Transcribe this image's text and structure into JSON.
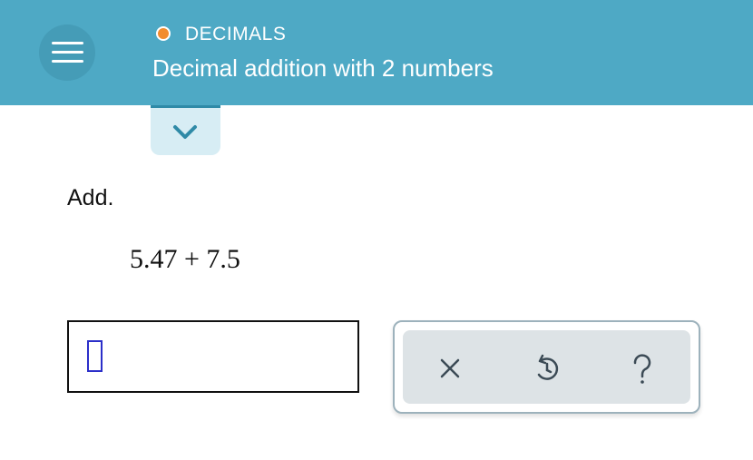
{
  "header": {
    "topic": "DECIMALS",
    "topic_status_color": "#f28c2e",
    "title": "Decimal addition with 2 numbers",
    "menu_icon": "hamburger-menu-icon",
    "background_color": "#4ea9c5"
  },
  "expand_tab": {
    "icon": "chevron-down-icon"
  },
  "question": {
    "instruction": "Add.",
    "expression": "5.47 + 7.5"
  },
  "answer": {
    "value": ""
  },
  "toolbar": {
    "buttons": [
      {
        "icon": "close-icon",
        "glyph": "×"
      },
      {
        "icon": "undo-icon",
        "glyph": "↺"
      },
      {
        "icon": "help-icon",
        "glyph": "?"
      }
    ]
  }
}
